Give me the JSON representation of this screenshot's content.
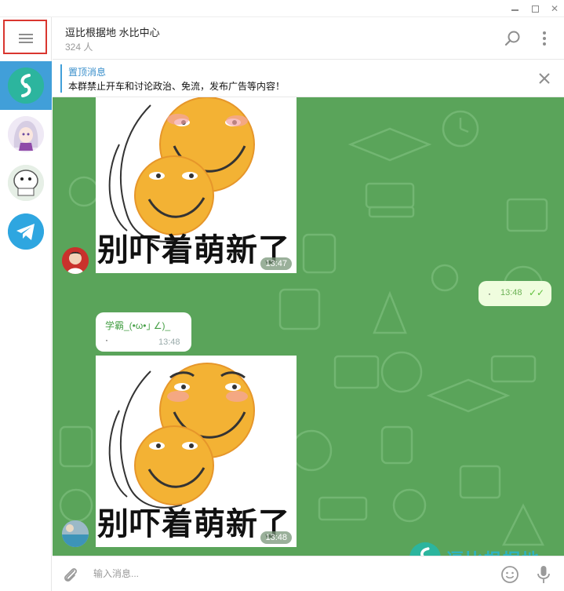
{
  "window": {
    "minimize_icon": "minimize-icon",
    "maximize_icon": "maximize-icon",
    "close_icon": "close-icon"
  },
  "sidebar": {
    "menu_icon": "hamburger-menu-icon",
    "chats": [
      {
        "name": "chat-gonghua",
        "active": true,
        "icon": "s-swirl-logo"
      },
      {
        "name": "chat-anime-avatar",
        "active": false
      },
      {
        "name": "chat-meme-avatar",
        "active": false
      },
      {
        "name": "chat-telegram",
        "active": false,
        "icon": "telegram-plane-icon"
      }
    ]
  },
  "header": {
    "title": "逗比根据地 水比中心",
    "subtitle": "324 人"
  },
  "pinned": {
    "title": "置顶消息",
    "text": "本群禁止开车和讨论政治、免流，发布广告等内容！"
  },
  "messages": [
    {
      "type": "sticker",
      "caption": "别吓着萌新了",
      "time": "13:47"
    },
    {
      "type": "outgoing",
      "text": "·",
      "time": "13:48"
    },
    {
      "type": "incoming",
      "sender": "学霸_(•ω•｣ ∠)_",
      "text": "·",
      "time": "13:48"
    },
    {
      "type": "sticker",
      "caption": "别吓着萌新了",
      "time": "13:48"
    }
  ],
  "watermark": {
    "text": "逗比根据地"
  },
  "composer": {
    "placeholder": "输入消息..."
  },
  "colors": {
    "accent": "#419fd9",
    "chat_background": "#5aa45a",
    "outgoing_bubble": "#effdde",
    "highlight_border": "#d9362f"
  }
}
